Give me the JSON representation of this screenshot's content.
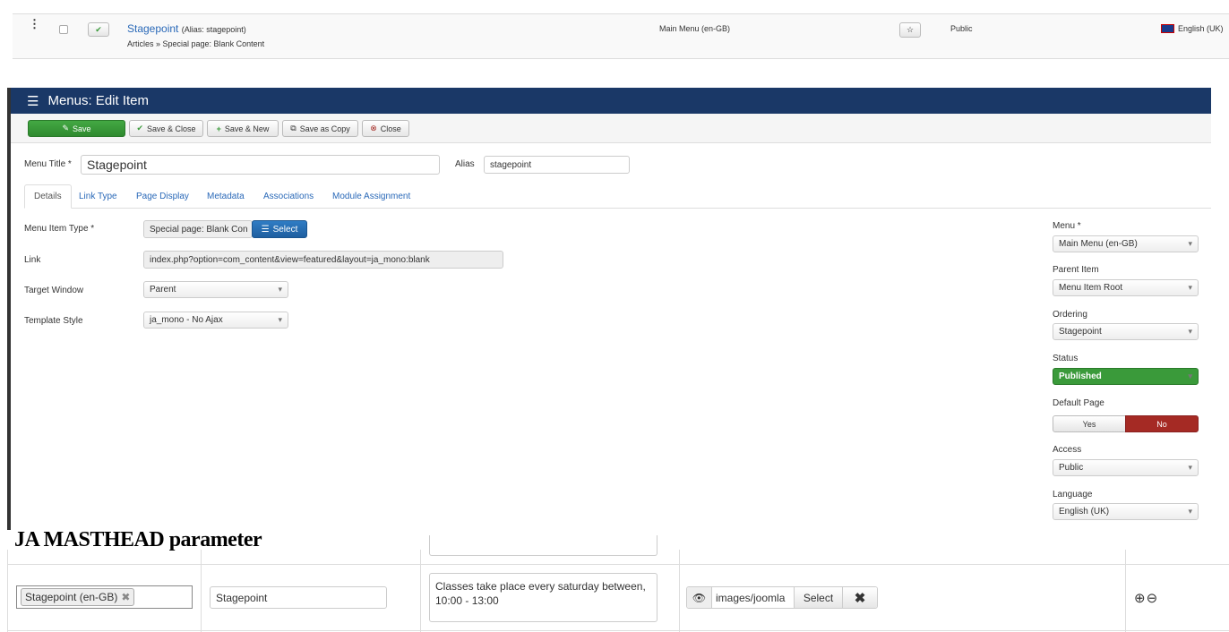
{
  "list_row": {
    "title": "Stagepoint",
    "alias": "(Alias: stagepoint)",
    "subtitle": "Articles » Special page: Blank Content",
    "menu": "Main Menu (en-GB)",
    "access": "Public",
    "language": "English (UK)"
  },
  "header": {
    "title": "Menus: Edit Item"
  },
  "toolbar": {
    "save": "Save",
    "save_close": "Save & Close",
    "save_new": "Save & New",
    "save_copy": "Save as Copy",
    "close": "Close"
  },
  "form": {
    "menu_title_label": "Menu Title *",
    "menu_title": "Stagepoint",
    "alias_label": "Alias",
    "alias": "stagepoint"
  },
  "tabs": [
    "Details",
    "Link Type",
    "Page Display",
    "Metadata",
    "Associations",
    "Module Assignment"
  ],
  "details": {
    "type_label": "Menu Item Type *",
    "type_value": "Special page: Blank Con",
    "select": "Select",
    "link_label": "Link",
    "link_value": "index.php?option=com_content&view=featured&layout=ja_mono:blank",
    "target_label": "Target Window",
    "target_value": "Parent",
    "template_label": "Template Style",
    "template_value": "ja_mono - No Ajax"
  },
  "sidebar": {
    "menu_label": "Menu *",
    "menu": "Main Menu (en-GB)",
    "parent_label": "Parent Item",
    "parent": "Menu Item Root",
    "ordering_label": "Ordering",
    "ordering": "Stagepoint",
    "status_label": "Status",
    "status": "Published",
    "default_label": "Default Page",
    "yes": "Yes",
    "no": "No",
    "access_label": "Access",
    "access": "Public",
    "language_label": "Language",
    "language": "English (UK)"
  },
  "masthead": {
    "heading": "JA MASTHEAD parameter",
    "tag": "Stagepoint (en-GB)",
    "title": "Stagepoint",
    "description": "Classes take place every saturday between, 10:00 - 13:00",
    "image_path": "images/joomla",
    "select": "Select"
  },
  "colors": {
    "header": "#1a3867",
    "green": "#3a9a3a",
    "red": "#a52a24",
    "link": "#2a69b8"
  }
}
